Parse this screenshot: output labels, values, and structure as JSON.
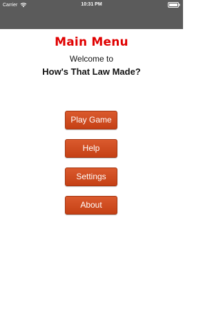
{
  "status_bar": {
    "carrier": "Carrier",
    "time": "10:31 PM",
    "wifi_icon": "wifi-icon",
    "battery_icon": "battery-icon"
  },
  "menu": {
    "title": "Main Menu",
    "welcome": "Welcome to",
    "app_name": "How's That Law Made?",
    "buttons": [
      {
        "label": "Play Game"
      },
      {
        "label": "Help"
      },
      {
        "label": "Settings"
      },
      {
        "label": "About"
      }
    ]
  },
  "colors": {
    "status_bar": "#5b5b5b",
    "title": "#e00000",
    "button": "#d04b20",
    "background": "#ffffff"
  }
}
